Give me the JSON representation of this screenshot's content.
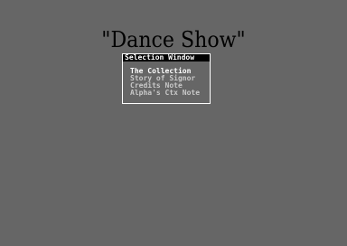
{
  "title": "\"Dance Show\"",
  "window": {
    "title": "Selection Window",
    "items": [
      {
        "label": "The Collection"
      },
      {
        "label": "Story of Signor"
      },
      {
        "label": "Credits Note"
      },
      {
        "label": "Alpha's Ctx Note"
      }
    ]
  },
  "colors": {
    "background": "#666666",
    "title_text": "#000000",
    "window_border": "#ffffff",
    "titlebar_bg": "#000000",
    "item_text": "#c8c8c8",
    "selected_text": "#ffffff"
  }
}
